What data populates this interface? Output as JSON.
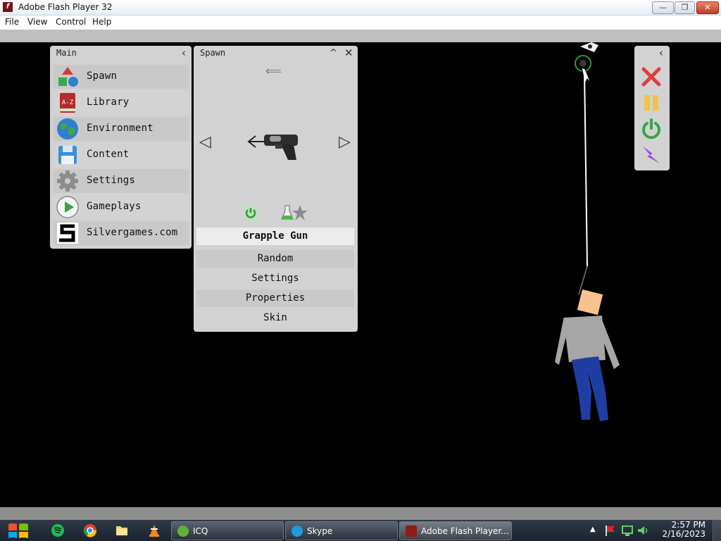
{
  "window": {
    "title": "Adobe Flash Player 32",
    "minimize": "—",
    "restore": "❐",
    "close": "✕"
  },
  "menu": [
    "File",
    "View",
    "Control",
    "Help"
  ],
  "main_panel": {
    "title": "Main",
    "collapse": "‹",
    "items": [
      {
        "label": "Spawn",
        "icon": "shapes-icon"
      },
      {
        "label": "Library",
        "icon": "book-az-icon"
      },
      {
        "label": "Environment",
        "icon": "globe-icon"
      },
      {
        "label": "Content",
        "icon": "floppy-disk-icon"
      },
      {
        "label": "Settings",
        "icon": "gear-icon"
      },
      {
        "label": "Gameplays",
        "icon": "play-icon"
      },
      {
        "label": "Silvergames.com",
        "icon": "silvergames-logo-icon"
      }
    ],
    "az_text": "A-Z"
  },
  "spawn_panel": {
    "title": "Spawn",
    "collapse": "^",
    "close": "✕",
    "arrow_hint": "⟸",
    "prev": "◁",
    "next": "▷",
    "selected_item": "Grapple Gun",
    "options": [
      "Random",
      "Settings",
      "Properties",
      "Skin"
    ]
  },
  "tool_panel": {
    "collapse": "‹",
    "tools": [
      {
        "name": "delete-tool",
        "icon": "x-icon",
        "color": "#e23c3c"
      },
      {
        "name": "pause-tool",
        "icon": "pause-icon",
        "color": "#f2c443"
      },
      {
        "name": "reset-tool",
        "icon": "power-icon",
        "color": "#3aa34a"
      },
      {
        "name": "shock-tool",
        "icon": "lightning-icon",
        "color": "#9a4fe0"
      }
    ]
  },
  "taskbar": {
    "pinned": [
      "windows-start-icon",
      "spotify-icon",
      "chrome-icon",
      "folder-icon",
      "vlc-icon"
    ],
    "tasks": [
      {
        "label": "ICQ",
        "color": "#5fb236",
        "icon": "icq-icon"
      },
      {
        "label": "Skype",
        "color": "#1e9be0",
        "icon": "skype-icon"
      },
      {
        "label": "Adobe Flash Player...",
        "color": "#8c1c1c",
        "icon": "flash-icon"
      }
    ],
    "tray_arrow": "▲",
    "time": "2:57 PM",
    "date": "2/16/2023"
  }
}
